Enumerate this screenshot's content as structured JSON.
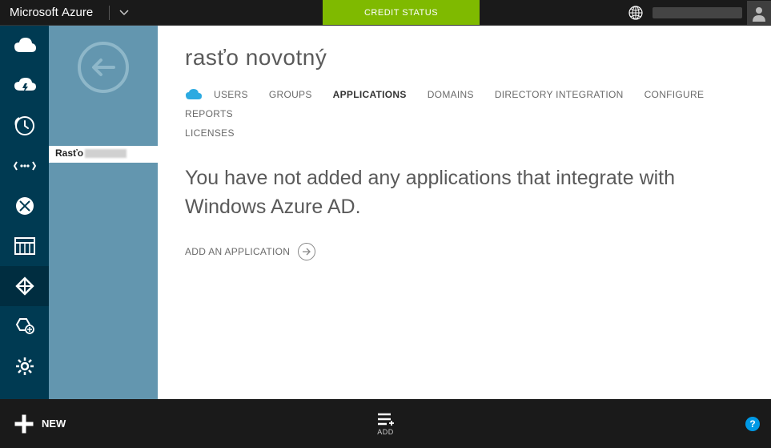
{
  "header": {
    "brand_ms": "Microsoft",
    "brand_azure": "Azure",
    "credit_status": "CREDIT STATUS"
  },
  "subnav": {
    "directory_name_visible": "Rasťo"
  },
  "page": {
    "title": "rasťo novotný",
    "tabs": {
      "users": "USERS",
      "groups": "GROUPS",
      "applications": "APPLICATIONS",
      "domains": "DOMAINS",
      "directory_integration": "DIRECTORY INTEGRATION",
      "configure": "CONFIGURE",
      "reports": "REPORTS",
      "licenses": "LICENSES"
    },
    "empty_message": "You have not added any applications that integrate with Windows Azure AD.",
    "add_application": "ADD AN APPLICATION"
  },
  "bottombar": {
    "new": "NEW",
    "add": "ADD"
  }
}
